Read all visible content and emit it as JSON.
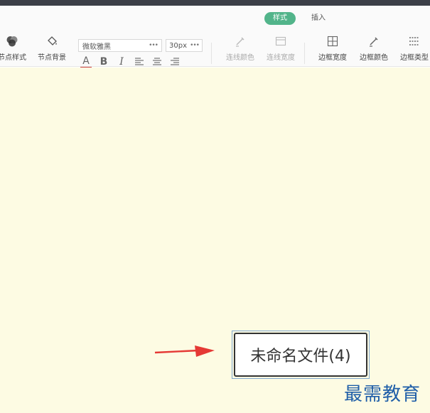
{
  "tabs": [
    {
      "label": "样式",
      "active": true
    },
    {
      "label": "插入",
      "active": false
    }
  ],
  "tools": {
    "node_style": "节点样式",
    "node_bg": "节点背景",
    "line_color": "连线颜色",
    "line_width": "连线宽度",
    "border_width": "边框宽度",
    "border_color": "边框颜色",
    "border_type": "边框类型"
  },
  "font": {
    "family": "微软雅黑",
    "size": "30px"
  },
  "format": {
    "font_color": "A",
    "bold": "B",
    "italic": "I"
  },
  "node": {
    "text": "未命名文件(4)"
  },
  "watermark": "最需教育",
  "colors": {
    "accent": "#52b48a",
    "canvas": "#fdfbe3",
    "arrow": "#e53935",
    "watermark": "#1f5ea8"
  }
}
